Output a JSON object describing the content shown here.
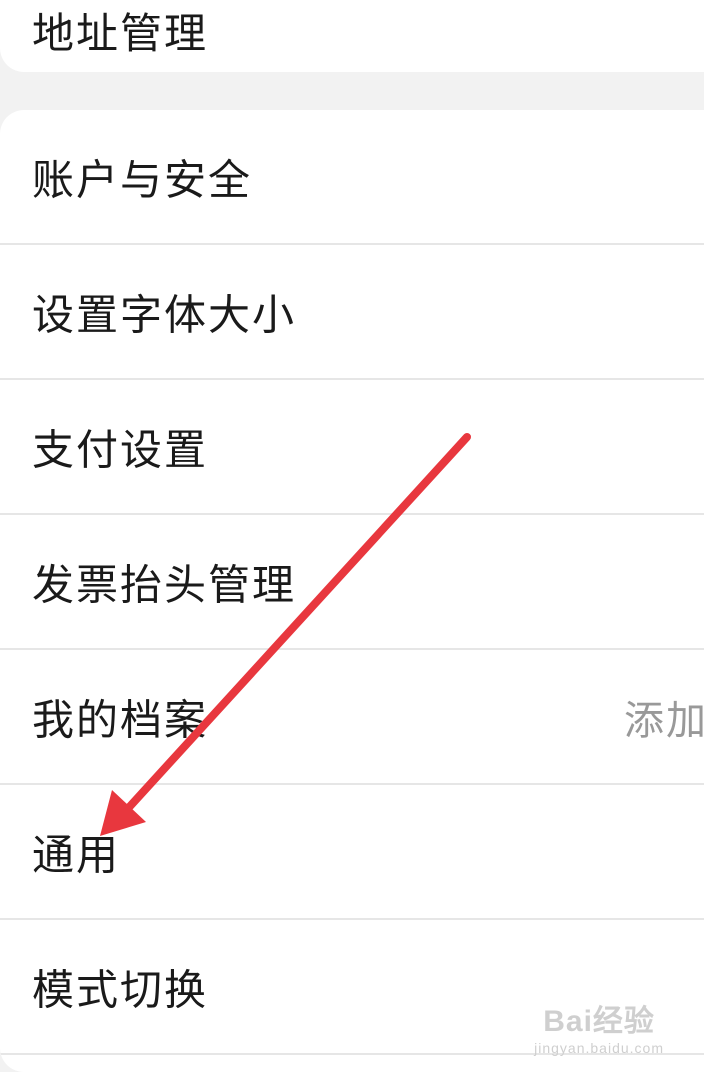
{
  "top_section": {
    "label": "地址管理"
  },
  "menu": {
    "items": [
      {
        "label": "账户与安全",
        "value": ""
      },
      {
        "label": "设置字体大小",
        "value": ""
      },
      {
        "label": "支付设置",
        "value": ""
      },
      {
        "label": "发票抬头管理",
        "value": ""
      },
      {
        "label": "我的档案",
        "value": "添加"
      },
      {
        "label": "通用",
        "value": ""
      },
      {
        "label": "模式切换",
        "value": ""
      }
    ]
  },
  "annotation": {
    "arrow_color": "#e8373e",
    "points_to": "通用"
  },
  "watermark": {
    "logo": "Bai经验",
    "url": "jingyan.baidu.com"
  },
  "colors": {
    "background": "#f2f2f2",
    "card": "#ffffff",
    "divider": "#e6e6e6",
    "text": "#1a1a1a",
    "secondary_text": "#999999"
  }
}
